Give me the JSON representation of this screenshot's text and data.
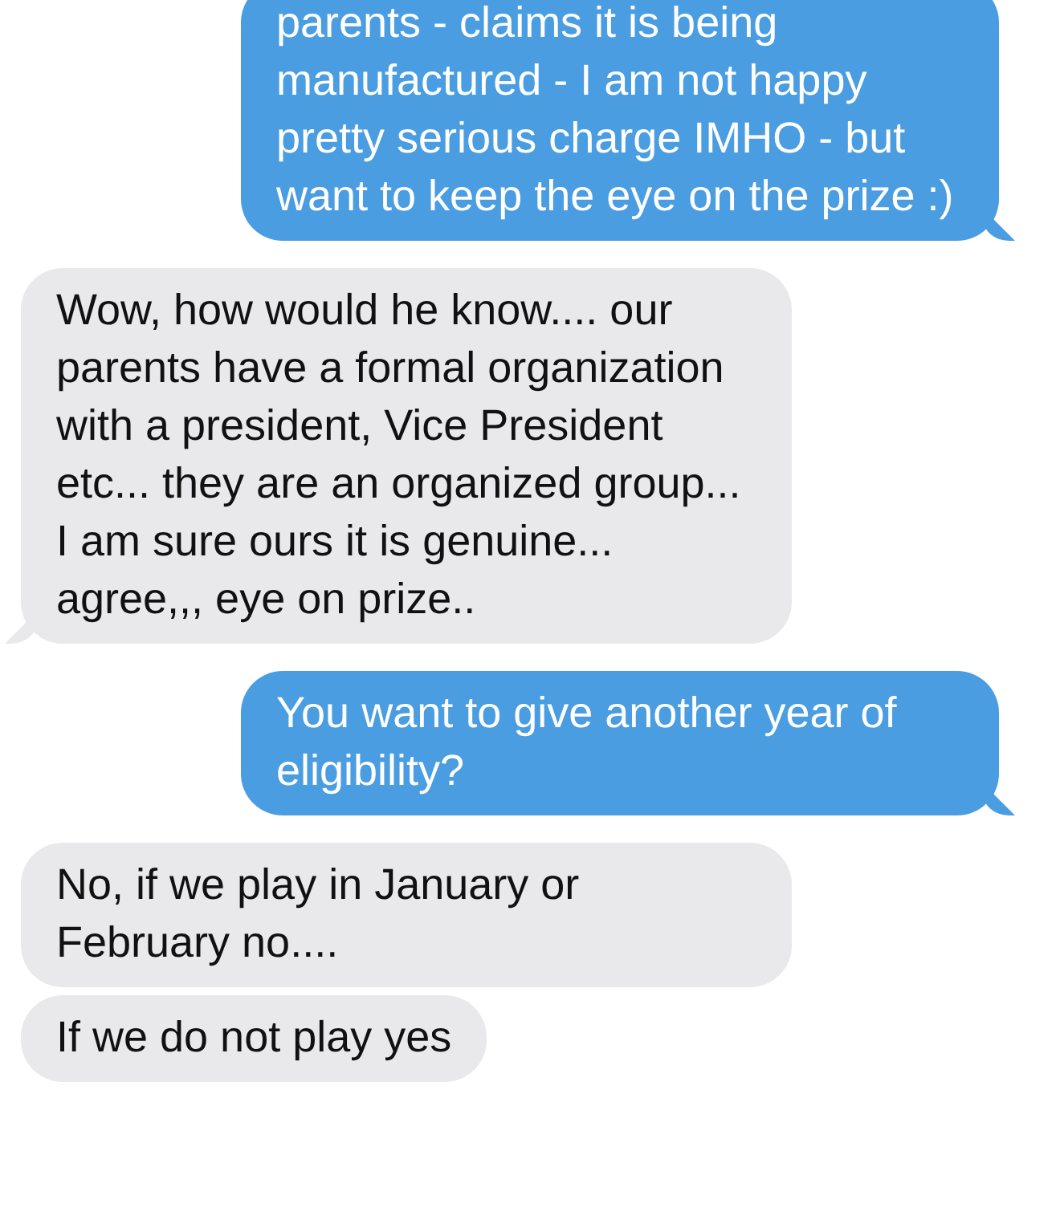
{
  "messages": [
    {
      "kind": "me",
      "tail": true,
      "text": "parents - claims it is being manufactured - I am not happy pretty serious charge IMHO - but want to keep the eye on the prize :)"
    },
    {
      "kind": "them",
      "tail": true,
      "text": "Wow, how would he know.... our parents have a formal organization with a president, Vice President etc... they are an organized group... I am sure ours it is genuine... agree,,, eye on prize.."
    },
    {
      "kind": "me",
      "tail": true,
      "text": "You want to give another year of eligibility?"
    },
    {
      "kind": "them",
      "tail": false,
      "text": "No, if we play in January or February no...."
    },
    {
      "kind": "them",
      "tail": false,
      "text": "If we do not play yes"
    }
  ]
}
